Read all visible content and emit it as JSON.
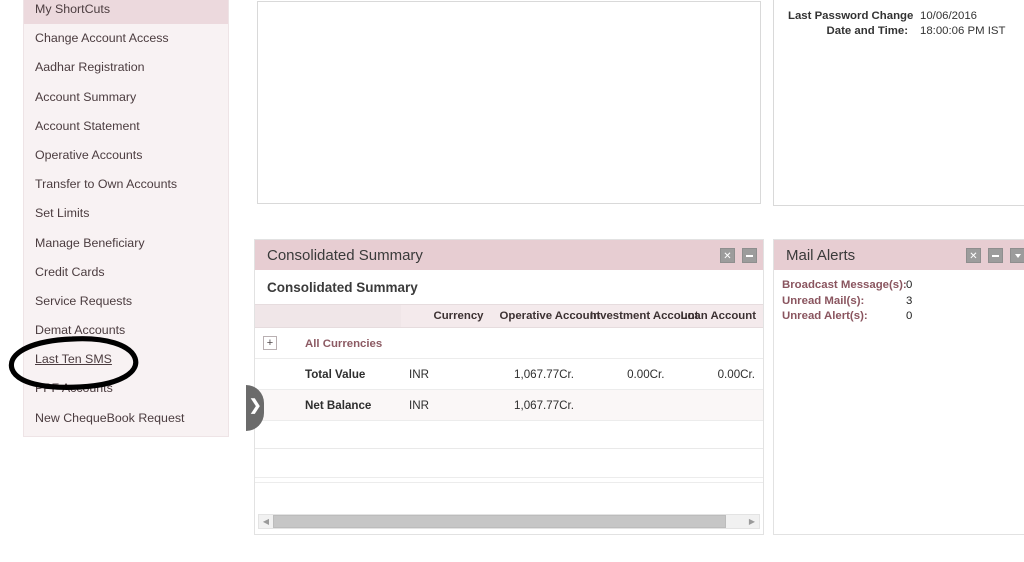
{
  "sidebar": {
    "items": [
      {
        "label": "My ShortCuts",
        "state": "active"
      },
      {
        "label": "Change Account Access",
        "state": "normal"
      },
      {
        "label": "Aadhar Registration",
        "state": "normal"
      },
      {
        "label": "Account Summary",
        "state": "normal"
      },
      {
        "label": "Account Statement",
        "state": "normal"
      },
      {
        "label": "Operative Accounts",
        "state": "normal"
      },
      {
        "label": "Transfer to Own Accounts",
        "state": "normal"
      },
      {
        "label": "Set Limits",
        "state": "normal"
      },
      {
        "label": "Manage Beneficiary",
        "state": "normal"
      },
      {
        "label": "Credit Cards",
        "state": "normal"
      },
      {
        "label": "Service Requests",
        "state": "normal"
      },
      {
        "label": "Demat Accounts",
        "state": "normal"
      },
      {
        "label": "Last Ten SMS",
        "state": "hover"
      },
      {
        "label": "PPF Accounts",
        "state": "normal"
      },
      {
        "label": "New ChequeBook Request",
        "state": "normal"
      }
    ]
  },
  "password_panel": {
    "label_line1": "Last Password Change",
    "label_line2": "Date and Time:",
    "value_line1": "10/06/2016",
    "value_line2": "18:00:06 PM IST"
  },
  "consolidated": {
    "title": "Consolidated Summary",
    "subtitle": "Consolidated Summary",
    "close_label": "✕",
    "minimize_label": "",
    "expand_row": {
      "plus_label": "+",
      "link_label": "All Currencies"
    },
    "columns": [
      "",
      "",
      "Currency",
      "Operative Account",
      "Investment Account",
      "Loan Account"
    ],
    "rows": [
      {
        "label": "Total Value",
        "currency": "INR",
        "operative": "1,067.77Cr.",
        "investment": "0.00Cr.",
        "loan": "0.00Cr."
      },
      {
        "label": "Net Balance",
        "currency": "INR",
        "operative": "1,067.77Cr.",
        "investment": "",
        "loan": ""
      }
    ],
    "scroll_left_label": "◀",
    "scroll_right_label": "▶"
  },
  "mail_alerts": {
    "title": "Mail Alerts",
    "close_label": "✕",
    "rows": [
      {
        "label": "Broadcast Message(s):",
        "value": "0"
      },
      {
        "label": "Unread Mail(s):",
        "value": "3"
      },
      {
        "label": "Unread Alert(s):",
        "value": "0"
      }
    ]
  },
  "flyout": {
    "chevron_label": "❯"
  },
  "colors": {
    "header_pink": "#e7cdd2",
    "sidebar_bg": "#f8f2f3",
    "sidebar_active": "#ecd9dd",
    "link_maroon": "#8c5a63",
    "mail_label": "#8a555f",
    "annotation": "#000000"
  }
}
